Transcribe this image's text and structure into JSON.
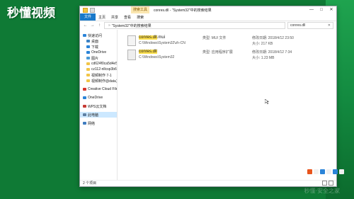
{
  "watermark": {
    "logo": "秒懂视频",
    "corner": "秒懂·安全之家"
  },
  "window": {
    "title": "conres.dll - \"System32\"中的搜索结果",
    "context_tab": "搜索工具",
    "controls": {
      "minimize": "—",
      "maximize": "□",
      "close": "✕"
    }
  },
  "ribbon": {
    "tabs": [
      "文件",
      "主页",
      "共享",
      "查看",
      "搜索"
    ]
  },
  "address_bar": {
    "back": "←",
    "forward": "→",
    "up": "↑",
    "path": [
      "»",
      "\"System32\"中的搜索结果"
    ],
    "search_value": "conres.dll",
    "search_clear": "✕"
  },
  "sidebar": {
    "items": [
      {
        "label": "快速访问",
        "icon": "star-icon",
        "level": 0
      },
      {
        "label": "桌面",
        "icon": "desktop-icon",
        "level": 1
      },
      {
        "label": "下载",
        "icon": "download-icon",
        "level": 1
      },
      {
        "label": "OneDrive",
        "icon": "cloud-icon",
        "level": 1
      },
      {
        "label": "图片",
        "icon": "picture-icon",
        "level": 1
      },
      {
        "label": "cd624f0ca5d4e5-7",
        "icon": "folder-icon",
        "level": 1
      },
      {
        "label": "cz112-nllcsp3b6f4",
        "icon": "folder-icon",
        "level": 1
      },
      {
        "label": "视频制作 7-1",
        "icon": "folder-icon",
        "level": 1
      },
      {
        "label": "视频制作@data文件",
        "icon": "folder-icon",
        "level": 1
      },
      {
        "label": "Creative Cloud Files",
        "icon": "cc-icon",
        "level": 0
      },
      {
        "label": "OneDrive",
        "icon": "cloud-icon",
        "level": 0
      },
      {
        "label": "WPS云文档",
        "icon": "wps-icon",
        "level": 0
      },
      {
        "label": "此电脑",
        "icon": "computer-icon",
        "level": 0
      },
      {
        "label": "网络",
        "icon": "network-icon",
        "level": 0
      }
    ]
  },
  "results": [
    {
      "name_hl": "conres.dll",
      "name_rest": ".mui",
      "path": "C:\\Windows\\System32\\zh-CN",
      "type": "类型: MUI 文件",
      "date": "修改日期: 2018/4/12 23:50",
      "size": "大小: 217 KB"
    },
    {
      "name_hl": "conres.dll",
      "name_rest": "",
      "path": "C:\\Windows\\System32",
      "type": "类型: 应用程序扩展",
      "date": "修改日期: 2018/4/12 7:34",
      "size": "大小: 1.23 MB"
    }
  ],
  "status": {
    "count": "2 个项目"
  },
  "colors": {
    "accent": "#1979ca",
    "highlight": "#ffe14d",
    "background": "#0f7a35"
  }
}
